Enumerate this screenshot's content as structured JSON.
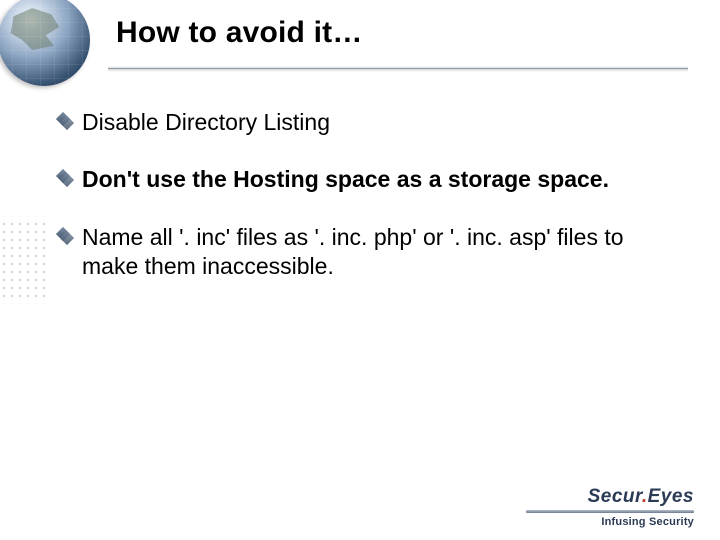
{
  "slide": {
    "title": "How to avoid it…"
  },
  "bullets": [
    {
      "text": "Disable Directory Listing",
      "bold": false
    },
    {
      "text": "Don't use the Hosting space as a storage space.",
      "bold": true
    },
    {
      "text": "Name all '. inc' files as '. inc. php' or '. inc. asp' files to make them inaccessible.",
      "bold": false
    }
  ],
  "footer": {
    "brand_before": "Secur",
    "brand_dot": ".",
    "brand_after": "Eyes",
    "tagline": "Infusing Security"
  }
}
